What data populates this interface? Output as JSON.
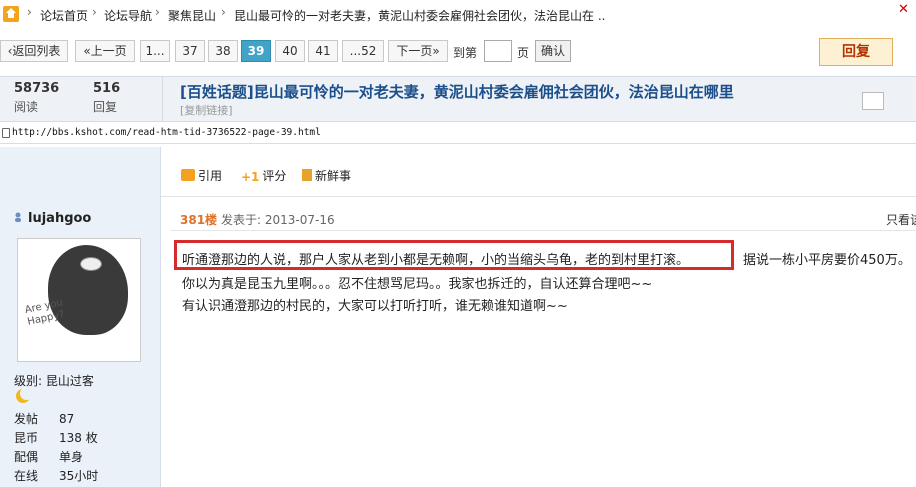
{
  "breadcrumb": {
    "items": [
      "论坛首页",
      "论坛导航",
      "聚焦昆山",
      "昆山最可怜的一对老夫妻，黄泥山村委会雇佣社会团伙，法治昆山在  .."
    ],
    "sep": "›"
  },
  "pager": {
    "back": "返回列表",
    "prev": "上一页",
    "pages": [
      "1...",
      "37",
      "38",
      "39",
      "40",
      "41",
      "...52"
    ],
    "current": "39",
    "next": "下一页",
    "goto_label": "到第",
    "goto_unit": "页",
    "confirm": "确认"
  },
  "reply_button": "回复",
  "thread": {
    "views_num": "58736",
    "views_label": "阅读",
    "replies_num": "516",
    "replies_label": "回复",
    "title": "[百姓话题]昆山最可怜的一对老夫妻，黄泥山村委会雇佣社会团伙，法治昆山在哪里",
    "copy_link": "[复制链接]"
  },
  "url": "http://bbs.kshot.com/read-htm-tid-3736522-page-39.html",
  "actions": {
    "quote": "引用",
    "rate_prefix": "+1",
    "rate": "评分",
    "news": "新鲜事"
  },
  "user": {
    "name": "lujahgoo",
    "avatar_text_1": "Are you",
    "avatar_text_2": "Happy?",
    "level_label": "级别:",
    "level": "昆山过客",
    "posts_label": "发帖",
    "posts": "87",
    "coins_label": "昆币",
    "coins": "138 枚",
    "spouse_label": "配偶",
    "spouse": "单身",
    "online_label": "在线",
    "online": "35小时"
  },
  "post": {
    "floor": "381楼",
    "posted_at": "发表于: 2013-07-16",
    "only_see": "只看该",
    "line1_highlight": "听通澄那边的人说，那户人家从老到小都是无赖啊，小的当缩头乌龟，老的到村里打滚。",
    "line1_rest": "据说一栋小平房要价450万。",
    "line2": "你以为真是昆玉九里啊。。。忍不住想骂尼玛。。我家也拆迁的，自认还算合理吧~~",
    "line3": "有认识通澄那边的村民的，大家可以打听打听，谁无赖谁知道啊~~"
  },
  "colors": {
    "highlight_border": "#d52b2b",
    "title_blue": "#1a4f8c",
    "current_page": "#41a3c8",
    "floor_orange": "#e0712b"
  }
}
